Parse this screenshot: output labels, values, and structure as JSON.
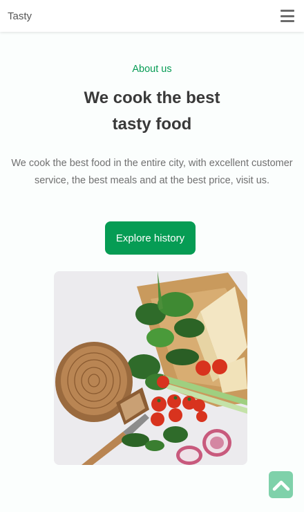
{
  "header": {
    "logo": "Tasty",
    "menu_icon": "hamburger-menu-icon"
  },
  "about": {
    "subtitle": "About us",
    "title": "We cook the best tasty food",
    "description": "We cook the best food in the entire city, with excellent customer service, the best meals and at the best price, visit us.",
    "button_label": "Explore history"
  },
  "scroll_top": {
    "icon": "chevron-up-icon"
  },
  "colors": {
    "accent": "#069c54",
    "accent_light": "#7fd1aa",
    "heading": "#393939",
    "text": "#707070",
    "background": "#fbfefd"
  }
}
